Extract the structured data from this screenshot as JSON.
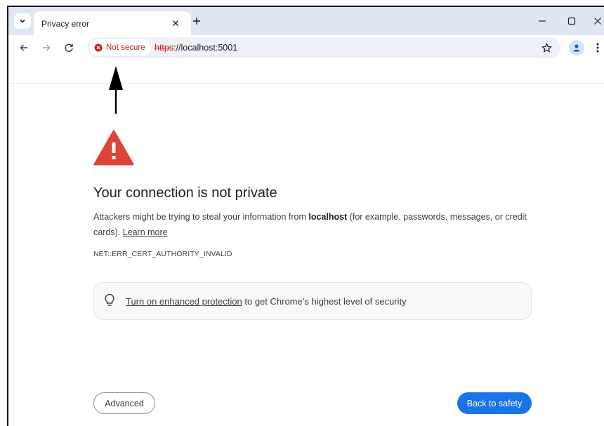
{
  "tab": {
    "title": "Privacy error"
  },
  "omnibox": {
    "security_label": "Not secure",
    "url_scheme": "https",
    "url_rest": "://localhost:5001"
  },
  "page": {
    "title": "Your connection is not private",
    "desc_before": "Attackers might be trying to steal your information from ",
    "desc_host": "localhost",
    "desc_after": " (for example, passwords, messages, or credit cards). ",
    "learn_more": "Learn more",
    "error_code": "NET::ERR_CERT_AUTHORITY_INVALID",
    "protection_link": "Turn on enhanced protection",
    "protection_rest": " to get Chrome’s highest level of security",
    "advanced_button": "Advanced",
    "back_button": "Back to safety"
  },
  "icons": {
    "tab_search": "chevron-down-icon",
    "tab_close": "close-icon",
    "new_tab": "plus-icon",
    "back": "arrow-left-icon",
    "forward": "arrow-right-icon",
    "reload": "reload-icon",
    "not_secure": "error-circle-icon",
    "bookmark": "star-icon",
    "profile": "person-icon",
    "menu": "kebab-menu-icon",
    "warning": "warning-triangle-icon",
    "bulb": "lightbulb-icon"
  },
  "colors": {
    "accent": "#1a73e8",
    "danger": "#c5221f",
    "warning": "#db4437",
    "tabstrip": "#dfe6f4"
  }
}
